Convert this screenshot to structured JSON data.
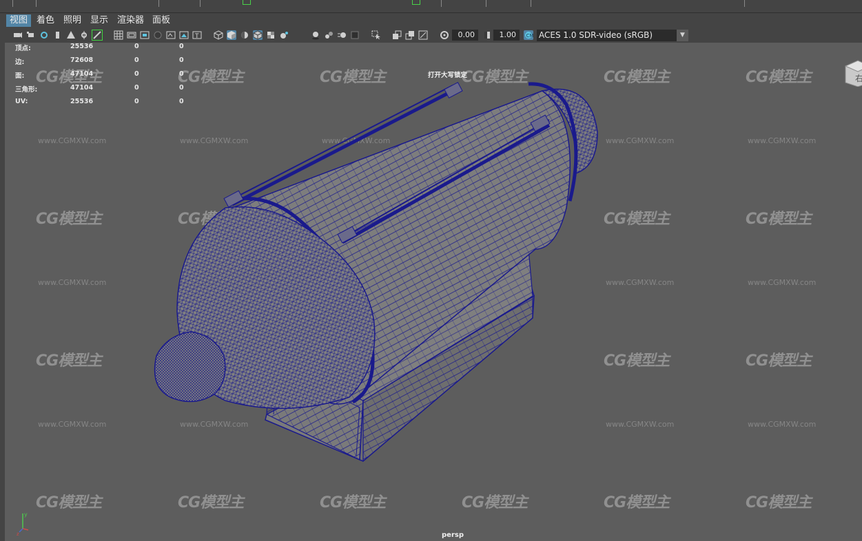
{
  "menu": {
    "items": [
      "视图",
      "着色",
      "照明",
      "显示",
      "渲染器",
      "面板"
    ],
    "active_index": 0
  },
  "toolbar": {
    "exposure_value": "0.00",
    "gamma_value": "1.00",
    "color_management": "ACES 1.0 SDR-video (sRGB)",
    "icons": [
      "select-camera-icon",
      "camera-attributes-icon",
      "bookmarks-icon",
      "image-plane-icon",
      "2d-pan-zoom-icon",
      "grease-pencil-icon",
      "grid-icon",
      "film-gate-icon",
      "resolution-gate-icon",
      "gate-mask-icon",
      "field-chart-icon",
      "safe-action-icon",
      "wireframe-icon",
      "smooth-shade-icon",
      "default-material-icon",
      "wireframe-on-shaded-icon",
      "textured-icon",
      "use-all-lights-icon",
      "shadows-icon",
      "screen-space-ao-icon",
      "motion-blur-icon",
      "anti-aliasing-icon",
      "isolate-select-icon",
      "xray-icon",
      "xray-joints-icon",
      "xray-active-components-icon",
      "exposure-icon",
      "gamma-icon",
      "view-transform-icon"
    ]
  },
  "hud": {
    "stats": [
      {
        "label": "顶点:",
        "value": "25536",
        "sel": "0",
        "sel2": "0"
      },
      {
        "label": "边:",
        "value": "72608",
        "sel": "0",
        "sel2": "0"
      },
      {
        "label": "面:",
        "value": "47104",
        "sel": "0",
        "sel2": "0"
      },
      {
        "label": "三角形:",
        "value": "47104",
        "sel": "0",
        "sel2": "0"
      },
      {
        "label": "UV:",
        "value": "25536",
        "sel": "0",
        "sel2": "0"
      }
    ],
    "message": "打开大写锁定",
    "camera": "persp"
  },
  "watermark": {
    "logo_text": "CG模型主",
    "url_text": "www.CGMXW.com"
  },
  "viewcube": {
    "label": "右"
  },
  "colors": {
    "wireframe": "#1a1a8c",
    "mesh_fill": "#7d7d7d",
    "viewport_bg": "#5d5d5d",
    "menu_active": "#5285a6"
  }
}
